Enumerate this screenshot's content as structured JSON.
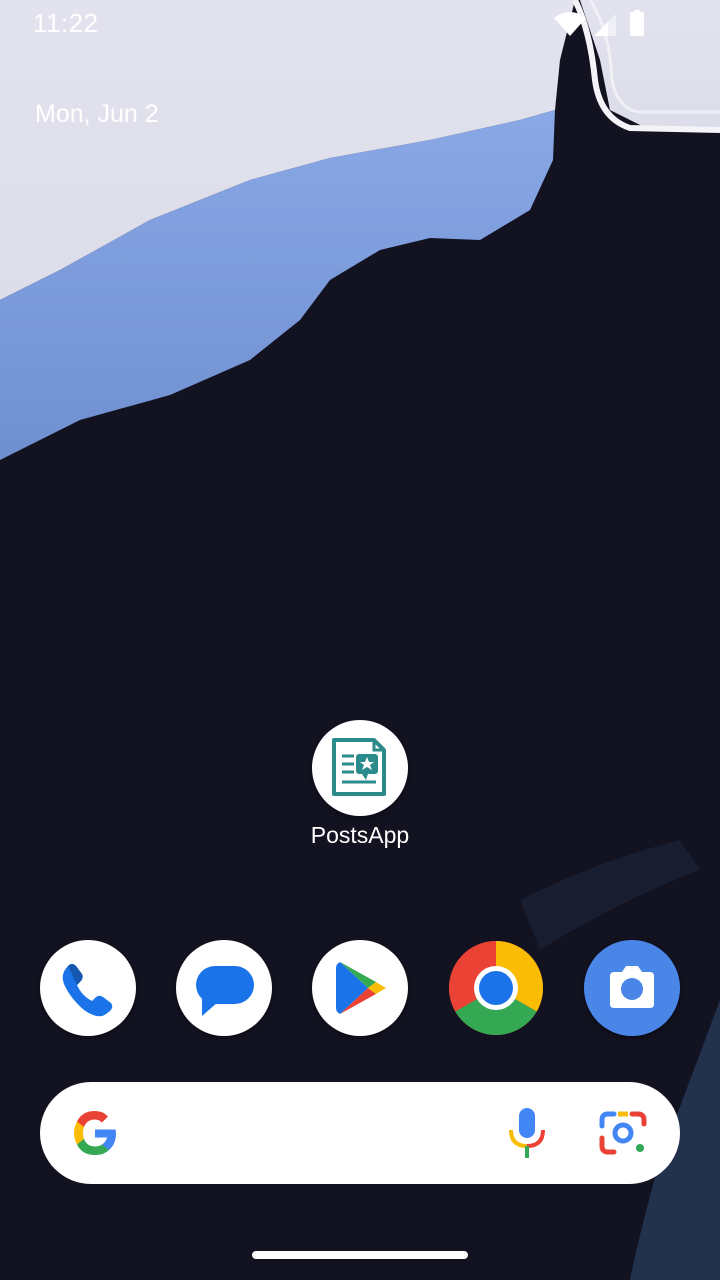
{
  "status_bar": {
    "time": "11:22",
    "icons": [
      "wifi-icon",
      "cell-signal-icon",
      "battery-icon"
    ]
  },
  "date_widget": {
    "text": "Mon, Jun 2"
  },
  "home": {
    "apps": [
      {
        "label": "PostsApp",
        "icon": "posts-app-icon",
        "accent": "#2b8a8a"
      }
    ]
  },
  "dock": {
    "apps": [
      {
        "name": "Phone",
        "icon": "phone-icon"
      },
      {
        "name": "Messages",
        "icon": "messages-icon"
      },
      {
        "name": "Play Store",
        "icon": "play-store-icon"
      },
      {
        "name": "Chrome",
        "icon": "chrome-icon"
      },
      {
        "name": "Camera",
        "icon": "camera-icon"
      }
    ]
  },
  "search_bar": {
    "icons": [
      "google-g-icon",
      "microphone-icon",
      "google-lens-icon"
    ]
  },
  "colors": {
    "google_blue": "#4285f4",
    "google_red": "#ea4335",
    "google_yellow": "#fbbc05",
    "google_green": "#34a853",
    "wallpaper_dark": "#121221",
    "wallpaper_light": "#e4e6f0",
    "wallpaper_blue": "#7f9fdc"
  }
}
